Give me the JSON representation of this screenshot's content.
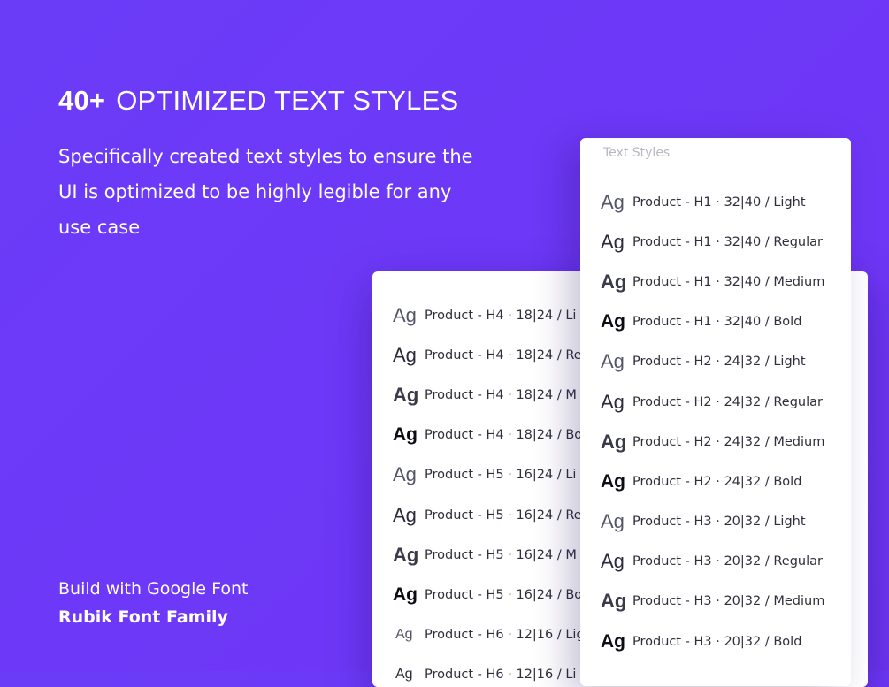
{
  "hero": {
    "count": "40+",
    "title": "OPTIMIZED TEXT STYLES",
    "description": "Specifically created text styles to ensure the UI is optimized to be highly legible for any use case"
  },
  "footer": {
    "line1": "Build with Google Font",
    "line2": "Rubik Font Family"
  },
  "panel_right": {
    "title": "Text Styles",
    "rows": [
      {
        "sample": "Ag",
        "label": "Product - H1 · 32|40 / Light"
      },
      {
        "sample": "Ag",
        "label": "Product - H1 · 32|40 / Regular"
      },
      {
        "sample": "Ag",
        "label": "Product - H1 · 32|40 / Medium"
      },
      {
        "sample": "Ag",
        "label": "Product - H1 · 32|40 / Bold"
      },
      {
        "sample": "Ag",
        "label": "Product - H2 · 24|32 / Light"
      },
      {
        "sample": "Ag",
        "label": "Product - H2 · 24|32 / Regular"
      },
      {
        "sample": "Ag",
        "label": "Product - H2 · 24|32 / Medium"
      },
      {
        "sample": "Ag",
        "label": "Product - H2 · 24|32 / Bold"
      },
      {
        "sample": "Ag",
        "label": "Product - H3 · 20|32 / Light"
      },
      {
        "sample": "Ag",
        "label": "Product - H3 · 20|32 / Regular"
      },
      {
        "sample": "Ag",
        "label": "Product - H3 · 20|32 / Medium"
      },
      {
        "sample": "Ag",
        "label": "Product - H3 · 20|32 / Bold"
      }
    ]
  },
  "panel_left": {
    "rows": [
      {
        "sample": "Ag",
        "label": "Product - H4 · 18|24 / Li"
      },
      {
        "sample": "Ag",
        "label": "Product - H4 · 18|24 / Re"
      },
      {
        "sample": "Ag",
        "label": "Product - H4 · 18|24 / M"
      },
      {
        "sample": "Ag",
        "label": "Product - H4 · 18|24 / Bo"
      },
      {
        "sample": "Ag",
        "label": "Product - H5 · 16|24 / Li"
      },
      {
        "sample": "Ag",
        "label": "Product - H5 · 16|24 / Re"
      },
      {
        "sample": "Ag",
        "label": "Product - H5 · 16|24 / M"
      },
      {
        "sample": "Ag",
        "label": "Product - H5 · 16|24 / Bo"
      },
      {
        "sample": "Ag",
        "label": "Product - H6 · 12|16 / Lig"
      },
      {
        "sample": "Ag",
        "label": "Product - H6 · 12|16 / Li"
      }
    ]
  },
  "colors": {
    "background": "#6a3cf8",
    "panel": "#ffffff",
    "text_on_background": "#ffffff"
  }
}
